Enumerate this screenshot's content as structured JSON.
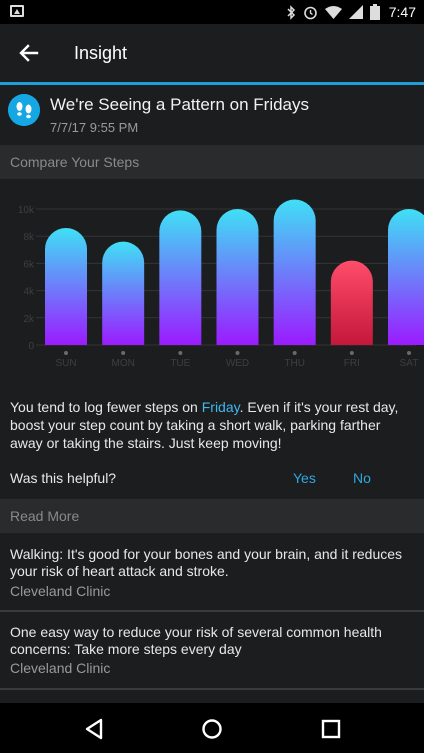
{
  "status": {
    "time": "7:47",
    "icons": [
      "image-icon",
      "bluetooth-icon",
      "alarm-icon",
      "wifi-icon",
      "signal-icon",
      "battery-icon"
    ]
  },
  "app_bar": {
    "title": "Insight",
    "back_icon": "arrow-left-icon"
  },
  "insight": {
    "title": "We're Seeing a Pattern on Fridays",
    "date": "7/7/17 9:55 PM",
    "icon": "footprints-icon"
  },
  "sections": {
    "compare": "Compare Your Steps",
    "read_more": "Read More"
  },
  "chart_data": {
    "type": "bar",
    "categories": [
      "SUN",
      "MON",
      "TUE",
      "WED",
      "THU",
      "FRI",
      "SAT"
    ],
    "values": [
      8600,
      7600,
      9900,
      10000,
      10700,
      6200,
      10000
    ],
    "y_ticks": [
      "0",
      "2k",
      "4k",
      "6k",
      "8k",
      "10k"
    ],
    "ylim": [
      0,
      10000
    ],
    "highlight_category": "FRI",
    "colors": {
      "normal_top": "#3fe0f5",
      "normal_bottom": "#9b1bff",
      "highlight_top": "#ff4d6b",
      "highlight_bottom": "#c4173a"
    }
  },
  "message": {
    "before": "You tend to log fewer steps on ",
    "highlight": "Friday",
    "after": ". Even if it's your rest day, boost your step count by taking a short walk, parking farther away or taking the stairs. Just keep moving!"
  },
  "feedback": {
    "question": "Was this helpful?",
    "yes": "Yes",
    "no": "No"
  },
  "articles": [
    {
      "text": "Walking: It's good for your bones and your brain, and it reduces your risk of heart attack and stroke.",
      "source": "Cleveland Clinic"
    },
    {
      "text": "One easy way to reduce your risk of several common health concerns: Take more steps every day",
      "source": "Cleveland Clinic"
    }
  ],
  "nav": {
    "back": "nav-back-icon",
    "home": "nav-home-icon",
    "recents": "nav-recents-icon"
  }
}
